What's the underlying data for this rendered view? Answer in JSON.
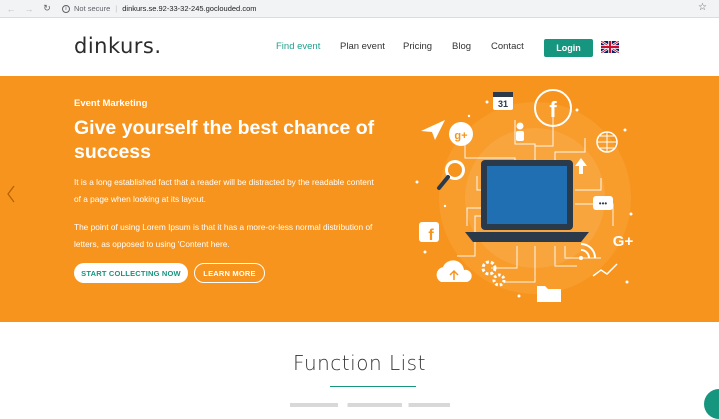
{
  "browser": {
    "not_secure": "Not secure",
    "url": "dinkurs.se.92-33-32-245.goclouded.com"
  },
  "header": {
    "logo": "dinkurs.",
    "nav": [
      "Find event",
      "Plan event",
      "Pricing",
      "Blog",
      "Contact"
    ],
    "login": "Login"
  },
  "hero": {
    "eyebrow": "Event Marketing",
    "title": "Give yourself the best chance of success",
    "paragraph1": "It is a long established fact that a reader will be distracted by the readable content of a page when looking at its layout.",
    "paragraph2": "The point of using Lorem Ipsum is that it has a more-or-less normal distribution of letters, as opposed to using 'Content here.",
    "cta_primary": "START COLLECTING NOW",
    "cta_secondary": "LEARN MORE",
    "calendar_day": "31"
  },
  "section": {
    "title": "Function List"
  },
  "colors": {
    "accent": "#16957f",
    "hero_bg": "#f7941d"
  }
}
